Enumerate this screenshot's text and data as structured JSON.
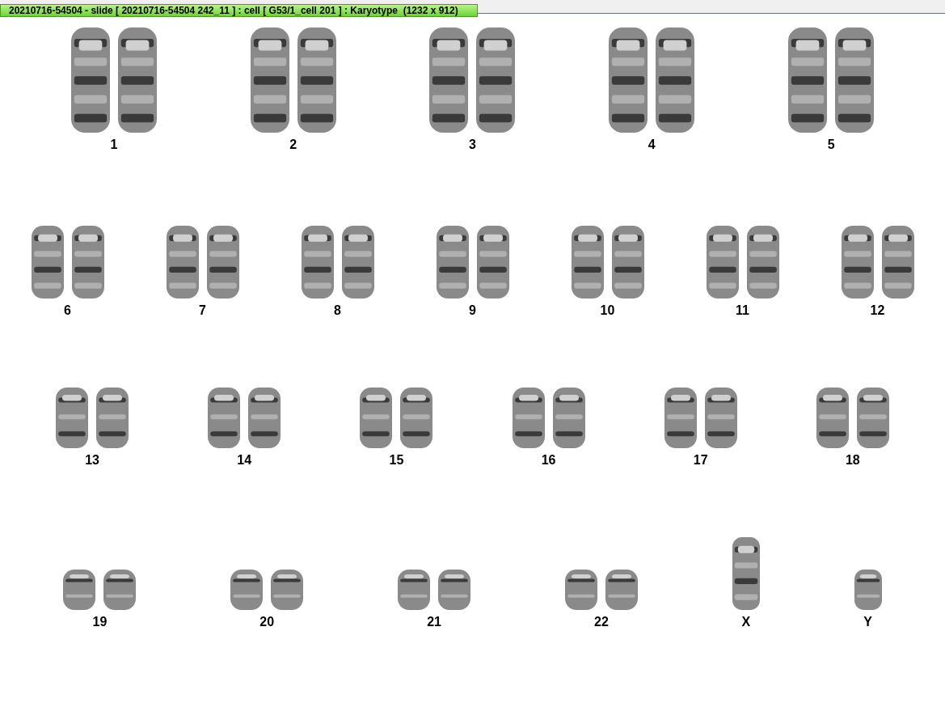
{
  "window": {
    "title": "20210716-54504 - slide [ 20210716-54504 242_11 ] : cell [ G53/1_cell 201 ] : Karyotype  (1232 x 912)"
  },
  "karyotype": {
    "rows": [
      {
        "items": [
          {
            "label": "1",
            "kind": "pair"
          },
          {
            "label": "2",
            "kind": "pair"
          },
          {
            "label": "3",
            "kind": "pair"
          },
          {
            "label": "4",
            "kind": "pair"
          },
          {
            "label": "5",
            "kind": "pair"
          }
        ]
      },
      {
        "items": [
          {
            "label": "6",
            "kind": "pair"
          },
          {
            "label": "7",
            "kind": "pair"
          },
          {
            "label": "8",
            "kind": "pair"
          },
          {
            "label": "9",
            "kind": "pair"
          },
          {
            "label": "10",
            "kind": "pair"
          },
          {
            "label": "11",
            "kind": "pair"
          },
          {
            "label": "12",
            "kind": "pair"
          }
        ]
      },
      {
        "items": [
          {
            "label": "13",
            "kind": "pair"
          },
          {
            "label": "14",
            "kind": "pair"
          },
          {
            "label": "15",
            "kind": "pair"
          },
          {
            "label": "16",
            "kind": "pair"
          },
          {
            "label": "17",
            "kind": "pair"
          },
          {
            "label": "18",
            "kind": "pair"
          }
        ]
      },
      {
        "items": [
          {
            "label": "19",
            "kind": "pair"
          },
          {
            "label": "20",
            "kind": "pair"
          },
          {
            "label": "21",
            "kind": "pair"
          },
          {
            "label": "22",
            "kind": "pair"
          },
          {
            "label": "X",
            "kind": "single"
          },
          {
            "label": "Y",
            "kind": "single"
          }
        ]
      }
    ]
  }
}
